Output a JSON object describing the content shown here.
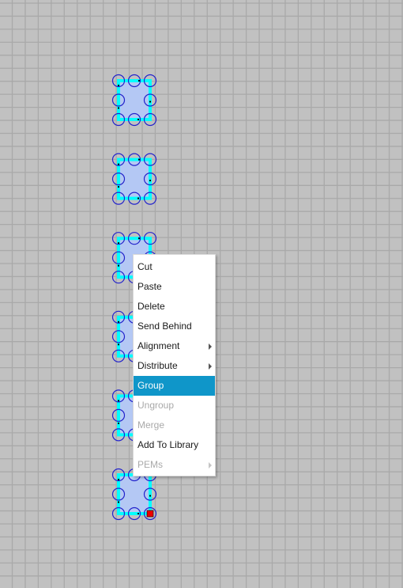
{
  "canvas": {
    "background_color": "#c1c1c1",
    "grid_line_color": "#a9a9a9",
    "shapes": [
      {
        "id": "shape-1",
        "selected_handle": false
      },
      {
        "id": "shape-2",
        "selected_handle": false
      },
      {
        "id": "shape-3",
        "selected_handle": false
      },
      {
        "id": "shape-4",
        "selected_handle": false
      },
      {
        "id": "shape-5",
        "selected_handle": false
      },
      {
        "id": "shape-6",
        "selected_handle": true
      }
    ],
    "colors": {
      "fill": "#b4c8f4",
      "outline": "#00ffff",
      "handle_circle": "#2222cc",
      "active_handle": "#ee0000"
    }
  },
  "context_menu": {
    "items": [
      {
        "label": "Cut",
        "enabled": true,
        "submenu": false,
        "highlighted": false
      },
      {
        "label": "Paste",
        "enabled": true,
        "submenu": false,
        "highlighted": false
      },
      {
        "label": "Delete",
        "enabled": true,
        "submenu": false,
        "highlighted": false
      },
      {
        "label": "Send Behind",
        "enabled": true,
        "submenu": false,
        "highlighted": false
      },
      {
        "label": "Alignment",
        "enabled": true,
        "submenu": true,
        "highlighted": false
      },
      {
        "label": "Distribute",
        "enabled": true,
        "submenu": true,
        "highlighted": false
      },
      {
        "label": "Group",
        "enabled": true,
        "submenu": false,
        "highlighted": true
      },
      {
        "label": "Ungroup",
        "enabled": false,
        "submenu": false,
        "highlighted": false
      },
      {
        "label": "Merge",
        "enabled": false,
        "submenu": false,
        "highlighted": false
      },
      {
        "label": "Add To Library",
        "enabled": true,
        "submenu": false,
        "highlighted": false
      },
      {
        "label": "PEMs",
        "enabled": false,
        "submenu": true,
        "highlighted": false
      }
    ],
    "highlight_color": "#0f96c9"
  }
}
